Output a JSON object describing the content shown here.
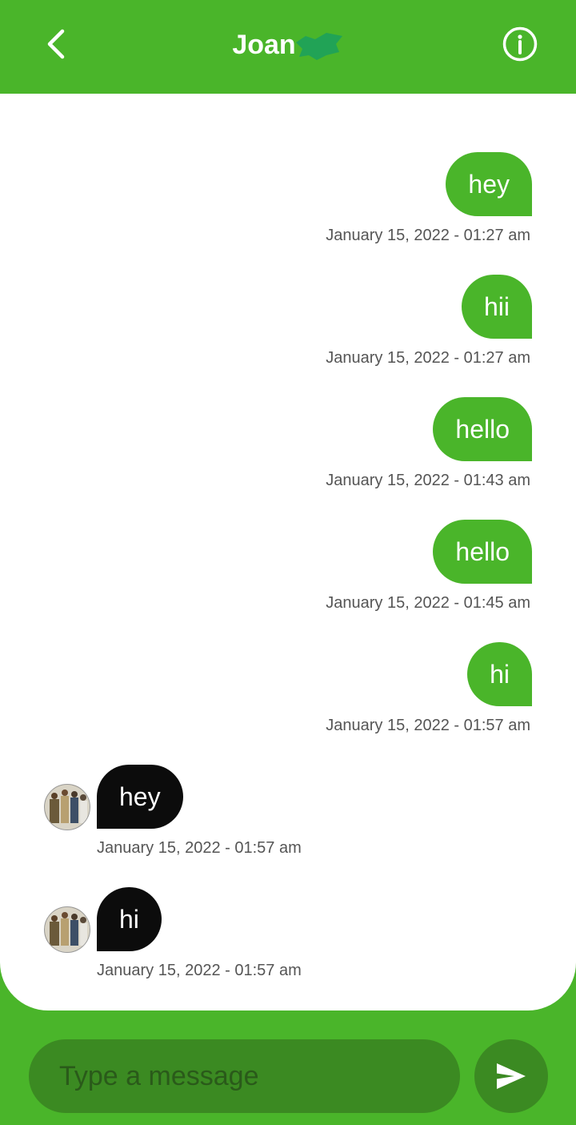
{
  "header": {
    "contact_name": "Joan",
    "back_icon": "chevron-left-icon",
    "info_icon": "info-icon"
  },
  "messages": [
    {
      "direction": "out",
      "text": "hey",
      "timestamp": "January 15, 2022 - 01:27 am"
    },
    {
      "direction": "out",
      "text": "hii",
      "timestamp": "January 15, 2022 - 01:27 am"
    },
    {
      "direction": "out",
      "text": "hello",
      "timestamp": "January 15, 2022 - 01:43 am"
    },
    {
      "direction": "out",
      "text": "hello",
      "timestamp": "January 15, 2022 - 01:45 am"
    },
    {
      "direction": "out",
      "text": "hi",
      "timestamp": "January 15, 2022 - 01:57 am"
    },
    {
      "direction": "in",
      "text": "hey",
      "timestamp": "January 15, 2022 - 01:57 am"
    },
    {
      "direction": "in",
      "text": "hi",
      "timestamp": "January 15, 2022 - 01:57 am"
    }
  ],
  "composer": {
    "placeholder": "Type a message",
    "value": "",
    "send_icon": "send-icon"
  },
  "colors": {
    "accent": "#4ab52a",
    "accent_dark": "#3b8a22",
    "incoming_bubble": "#0c0c0c",
    "chat_background": "#ffffff"
  }
}
